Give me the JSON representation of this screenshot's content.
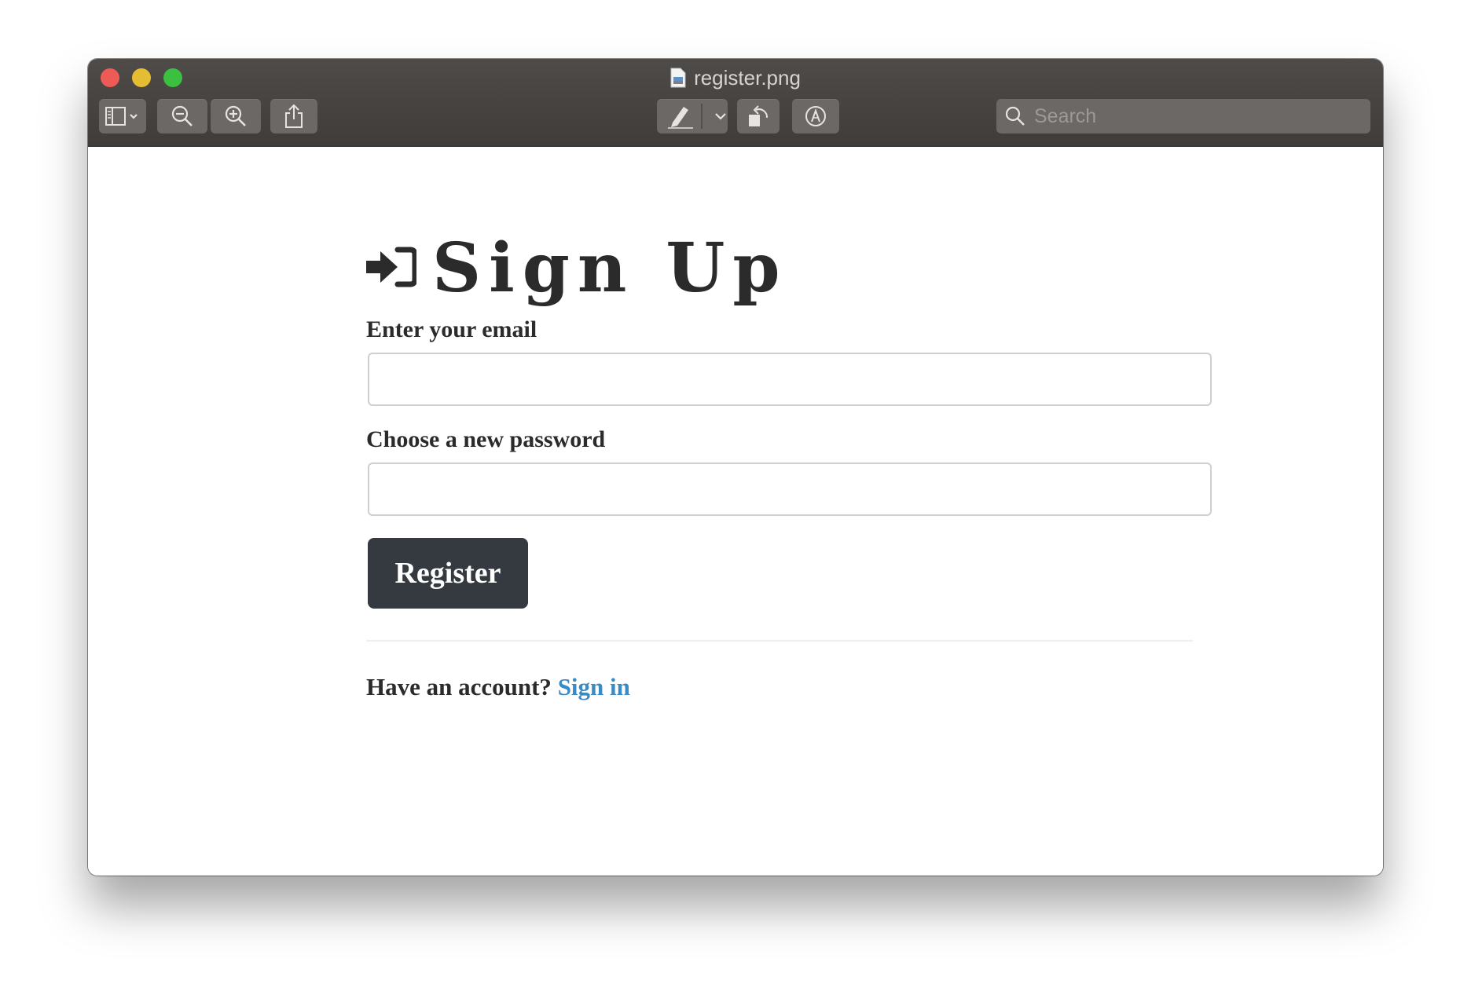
{
  "window": {
    "title": "register.png"
  },
  "toolbar": {
    "items": [
      "sidebar-toggle",
      "zoom-out",
      "zoom-in",
      "share",
      "markup-pen",
      "rotate",
      "annotate"
    ],
    "search_placeholder": "Search"
  },
  "signup": {
    "title": "Sign Up",
    "email_label": "Enter your email",
    "email_value": "",
    "password_label": "Choose a new password",
    "password_value": "",
    "register_label": "Register",
    "footer_prompt": "Have an account?",
    "signin_link": "Sign in"
  },
  "colors": {
    "titlebar": "#45423f",
    "button_dark": "#343a40",
    "link": "#3a8ac4"
  }
}
